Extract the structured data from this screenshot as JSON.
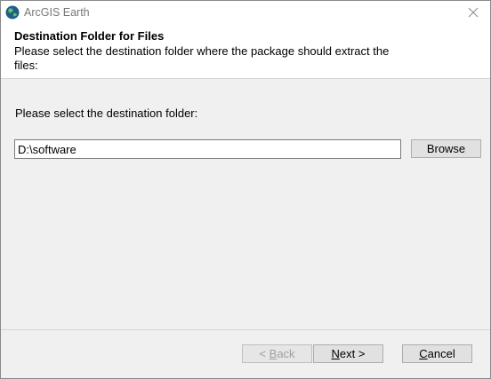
{
  "window": {
    "title": "ArcGIS Earth",
    "close_glyph": "✕"
  },
  "header": {
    "title": "Destination Folder for Files",
    "description": "Please select the destination folder where the package should extract the files:"
  },
  "main": {
    "prompt": "Please select the destination folder:",
    "path_value": "D:\\software",
    "browse_label": "Browse"
  },
  "footer": {
    "back": {
      "prefix": "< ",
      "mnemonic": "B",
      "rest": "ack"
    },
    "next": {
      "mnemonic": "N",
      "rest": "ext >"
    },
    "cancel": {
      "mnemonic": "C",
      "rest": "ancel"
    }
  },
  "icons": {
    "app": "globe-icon",
    "close": "close-icon"
  },
  "colors": {
    "window_bg": "#f0f0f0",
    "header_bg": "#ffffff",
    "button_bg": "#e1e1e1",
    "disabled_text": "#a0a0a0"
  }
}
